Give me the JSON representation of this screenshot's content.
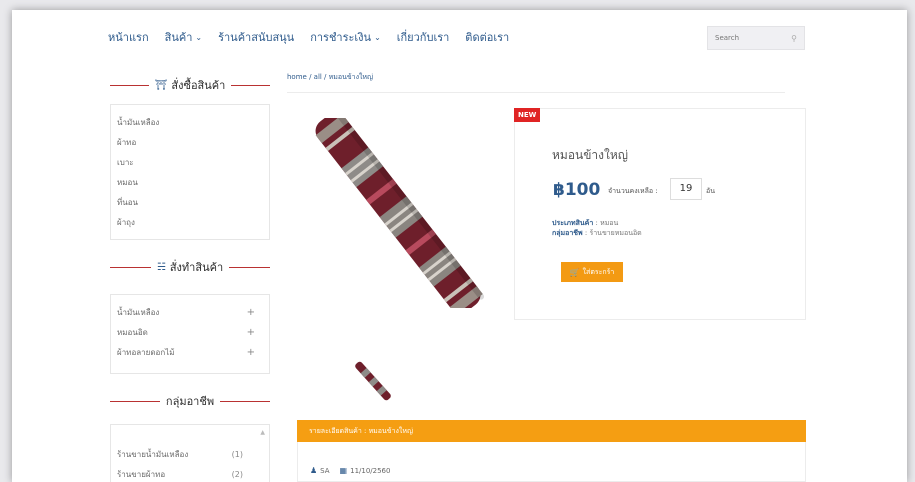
{
  "nav": {
    "items": [
      {
        "label": "หน้าแรก",
        "dropdown": false
      },
      {
        "label": "สินค้า",
        "dropdown": true
      },
      {
        "label": "ร้านค้าสนับสนุน",
        "dropdown": false
      },
      {
        "label": "การชำระเงิน",
        "dropdown": true
      },
      {
        "label": "เกี่ยวกับเรา",
        "dropdown": false
      },
      {
        "label": "ติดต่อเรา",
        "dropdown": false
      }
    ],
    "search_placeholder": "Search"
  },
  "sidebar": {
    "order_title": "สั่งซื้อสินค้า",
    "order_items": [
      "น้ำมันเหลือง",
      "ผ้าทอ",
      "เบาะ",
      "หมอน",
      "ที่นอน",
      "ผ้าถุง"
    ],
    "custom_title": "สั่งทำสินค้า",
    "custom_items": [
      "น้ำมันเหลือง",
      "หมอนอิด",
      "ผ้าทอลายดอกไม้"
    ],
    "group_title": "กลุ่มอาชีพ",
    "group_items": [
      {
        "label": "ร้านขายน้ำมันเหลือง",
        "count": "(1)"
      },
      {
        "label": "ร้านขายผ้าทอ",
        "count": "(2)"
      }
    ]
  },
  "breadcrumb": "home / all / หมอนข้างใหญ่",
  "product": {
    "badge": "NEW",
    "title": "หมอนข้างใหญ่",
    "price": "฿100",
    "stock_label": "จำนวนคงเหลือ :",
    "stock_value": "19",
    "stock_unit": "อัน",
    "type_label": "ประเภทสินค้า",
    "type_value": " : หมอน",
    "group_label": "กลุ่มอาชีพ",
    "group_value": " : ร้านขายหมอนอิด",
    "cart_label": "ใส่ตระกร้า"
  },
  "details": {
    "bar_label": "รายละเอียดสินค้า : หมอนข้างใหญ่",
    "author": "SA",
    "date": "11/10/2560"
  },
  "colors": {
    "accent_blue": "#2f5b8c",
    "orange": "#f59e12",
    "red_badge": "#e02424",
    "divider_red": "#b93232"
  }
}
